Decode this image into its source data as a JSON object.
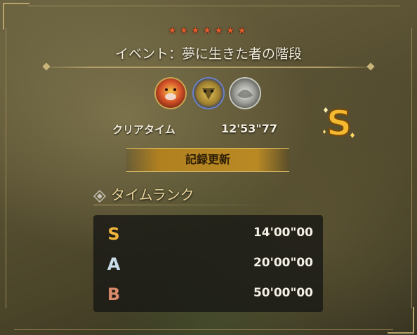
{
  "quest": {
    "stars": "★★★★★★★",
    "title": "イベント：夢に生きた者の階段",
    "monsters": [
      "red-monster-icon",
      "gold-monster-icon",
      "silver-monster-icon"
    ]
  },
  "result": {
    "clear_label": "クリアタイム",
    "clear_time": "12'53\"77",
    "achieved_rank": "S",
    "record_label": "記録更新"
  },
  "time_rank": {
    "heading": "タイムランク",
    "rows": [
      {
        "rank": "S",
        "time": "14'00\"00",
        "color": "#f0b43a"
      },
      {
        "rank": "A",
        "time": "20'00\"00",
        "color": "#c8dde8"
      },
      {
        "rank": "B",
        "time": "50'00\"00",
        "color": "#d98a6a"
      }
    ]
  }
}
